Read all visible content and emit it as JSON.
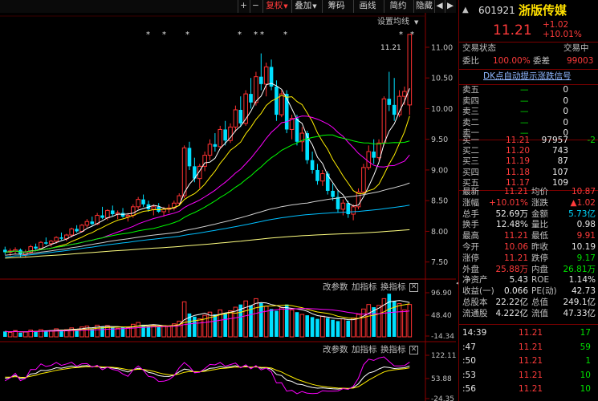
{
  "toolbar": {
    "arrow_left": "<",
    "plus": "+",
    "minus": "−",
    "fuquan": "复权",
    "diejia": "叠加",
    "chouma": "筹码",
    "huaxian": "画线",
    "jianji": "简约",
    "yincang": "隐藏",
    "nav_left": "◀",
    "nav_right": "▶"
  },
  "main_chart": {
    "ma_setting": "设置均线",
    "high_label": "11.21",
    "price_ticks": [
      "11.00",
      "10.50",
      "10.00",
      "9.50",
      "9.00",
      "8.50",
      "8.00",
      "7.50"
    ],
    "star_marks": [
      "*",
      "*",
      "*",
      "*",
      "*",
      "*",
      "*",
      "*",
      "*"
    ]
  },
  "vol_panel": {
    "ctl_change": "改参数",
    "ctl_add": "加指标",
    "ctl_switch": "换指标",
    "ctl_close": "✕",
    "ticks": [
      "96.90",
      "48.40",
      "-14.34"
    ]
  },
  "kdj_panel": {
    "ctl_change": "改参数",
    "ctl_add": "加指标",
    "ctl_switch": "换指标",
    "ctl_close": "✕",
    "ticks": [
      "122.11",
      "53.88",
      "-24.35"
    ]
  },
  "chart_data": {
    "type": "candlestick",
    "ylim": [
      7.3,
      11.3
    ],
    "candles": [
      [
        7.7,
        7.75,
        7.62,
        7.66
      ],
      [
        7.66,
        7.72,
        7.6,
        7.68
      ],
      [
        7.68,
        7.74,
        7.63,
        7.7
      ],
      [
        7.7,
        7.72,
        7.58,
        7.62
      ],
      [
        7.62,
        7.7,
        7.57,
        7.66
      ],
      [
        7.66,
        7.78,
        7.64,
        7.75
      ],
      [
        7.75,
        7.8,
        7.7,
        7.72
      ],
      [
        7.72,
        7.84,
        7.7,
        7.82
      ],
      [
        7.82,
        7.9,
        7.78,
        7.8
      ],
      [
        7.8,
        7.86,
        7.75,
        7.84
      ],
      [
        7.84,
        7.92,
        7.8,
        7.9
      ],
      [
        7.9,
        7.98,
        7.86,
        7.88
      ],
      [
        7.88,
        7.96,
        7.84,
        7.94
      ],
      [
        7.94,
        8.06,
        7.9,
        8.04
      ],
      [
        8.04,
        8.1,
        7.98,
        8.0
      ],
      [
        8.0,
        8.12,
        7.98,
        8.1
      ],
      [
        8.1,
        8.2,
        8.06,
        8.16
      ],
      [
        8.16,
        8.24,
        8.1,
        8.12
      ],
      [
        8.12,
        8.3,
        8.1,
        8.26
      ],
      [
        8.26,
        8.4,
        8.2,
        8.22
      ],
      [
        8.22,
        8.36,
        8.18,
        8.34
      ],
      [
        8.34,
        8.42,
        8.25,
        8.28
      ],
      [
        8.28,
        8.34,
        8.2,
        8.3
      ],
      [
        8.3,
        8.38,
        8.22,
        8.24
      ],
      [
        8.24,
        8.3,
        8.16,
        8.26
      ],
      [
        8.26,
        8.44,
        8.22,
        8.4
      ],
      [
        8.4,
        8.56,
        8.36,
        8.52
      ],
      [
        8.52,
        8.6,
        8.4,
        8.44
      ],
      [
        8.44,
        8.5,
        8.32,
        8.36
      ],
      [
        8.36,
        8.44,
        8.26,
        8.4
      ],
      [
        8.4,
        8.46,
        8.3,
        8.32
      ],
      [
        8.32,
        8.4,
        8.24,
        8.36
      ],
      [
        8.36,
        8.44,
        8.3,
        8.38
      ],
      [
        8.38,
        8.5,
        8.34,
        8.46
      ],
      [
        8.46,
        8.62,
        8.42,
        8.58
      ],
      [
        8.58,
        9.4,
        8.54,
        9.36
      ],
      [
        9.36,
        9.46,
        9.0,
        9.06
      ],
      [
        9.06,
        9.2,
        8.8,
        8.86
      ],
      [
        8.86,
        9.1,
        8.7,
        9.06
      ],
      [
        9.06,
        9.3,
        8.98,
        9.24
      ],
      [
        9.24,
        9.5,
        9.16,
        9.42
      ],
      [
        9.42,
        9.6,
        9.3,
        9.38
      ],
      [
        9.38,
        9.72,
        9.36,
        9.66
      ],
      [
        9.66,
        9.8,
        9.4,
        9.48
      ],
      [
        9.48,
        9.76,
        9.44,
        9.7
      ],
      [
        9.7,
        10.05,
        9.62,
        9.98
      ],
      [
        9.98,
        10.2,
        9.7,
        9.76
      ],
      [
        9.76,
        10.3,
        9.72,
        10.24
      ],
      [
        10.24,
        10.5,
        10.0,
        10.1
      ],
      [
        10.1,
        10.6,
        10.05,
        10.52
      ],
      [
        10.52,
        10.9,
        10.3,
        10.4
      ],
      [
        10.4,
        10.75,
        10.2,
        10.68
      ],
      [
        10.68,
        10.8,
        10.3,
        10.36
      ],
      [
        10.36,
        10.46,
        9.8,
        9.9
      ],
      [
        9.9,
        10.3,
        9.86,
        10.24
      ],
      [
        10.24,
        10.3,
        9.6,
        9.66
      ],
      [
        9.66,
        9.9,
        9.5,
        9.84
      ],
      [
        9.84,
        9.9,
        9.4,
        9.46
      ],
      [
        9.46,
        9.7,
        9.3,
        9.6
      ],
      [
        9.6,
        9.64,
        9.1,
        9.16
      ],
      [
        9.16,
        9.3,
        8.94,
        9.0
      ],
      [
        9.0,
        9.1,
        8.76,
        8.82
      ],
      [
        8.82,
        9.0,
        8.74,
        8.94
      ],
      [
        8.94,
        8.98,
        8.6,
        8.66
      ],
      [
        8.66,
        8.78,
        8.5,
        8.56
      ],
      [
        8.56,
        8.66,
        8.3,
        8.36
      ],
      [
        8.36,
        8.52,
        8.26,
        8.46
      ],
      [
        8.46,
        8.5,
        8.22,
        8.28
      ],
      [
        8.28,
        8.44,
        8.18,
        8.4
      ],
      [
        8.4,
        8.7,
        8.36,
        8.64
      ],
      [
        8.64,
        9.1,
        8.6,
        9.04
      ],
      [
        9.04,
        9.4,
        9.0,
        9.3
      ],
      [
        9.3,
        9.5,
        9.1,
        9.2
      ],
      [
        9.2,
        9.5,
        9.16,
        9.44
      ],
      [
        9.44,
        10.2,
        9.4,
        10.16
      ],
      [
        10.16,
        10.6,
        9.96,
        10.06
      ],
      [
        10.06,
        10.5,
        9.8,
        9.9
      ],
      [
        9.9,
        10.3,
        9.86,
        10.2
      ],
      [
        10.2,
        10.36,
        10.06,
        10.28
      ],
      [
        10.06,
        11.21,
        9.9,
        11.21
      ]
    ],
    "volumes": [
      12,
      10,
      14,
      9,
      11,
      15,
      12,
      16,
      13,
      14,
      18,
      15,
      16,
      20,
      17,
      22,
      24,
      19,
      26,
      23,
      25,
      21,
      19,
      22,
      20,
      28,
      32,
      27,
      24,
      26,
      22,
      25,
      23,
      29,
      35,
      78,
      52,
      45,
      40,
      48,
      55,
      50,
      60,
      52,
      58,
      66,
      72,
      80,
      70,
      85,
      75,
      68,
      62,
      58,
      65,
      72,
      60,
      55,
      50,
      48,
      44,
      40,
      46,
      42,
      38,
      35,
      40,
      36,
      42,
      50,
      62,
      72,
      66,
      70,
      85,
      96,
      80,
      74,
      60,
      72
    ],
    "vol_labels": [
      "96.90",
      "48.40",
      "-14.34"
    ],
    "kdj_labels": [
      "122.11",
      "53.88",
      "-24.35"
    ]
  },
  "quote": {
    "code": "601921",
    "name": "浙版传媒",
    "price": "11.21",
    "change": "+1.02",
    "change_pct": "+10.01%",
    "state_label": "交易状态",
    "state_value": "交易中",
    "weibi_label": "委比",
    "weibi_value": "100.00%",
    "weicha_label": "委差",
    "weicha_value": "99003",
    "signal_text": "DK点自动提示涨跌信号",
    "asks": [
      {
        "label": "卖五",
        "price": "—",
        "vol": "0"
      },
      {
        "label": "卖四",
        "price": "—",
        "vol": "0"
      },
      {
        "label": "卖三",
        "price": "—",
        "vol": "0"
      },
      {
        "label": "卖二",
        "price": "—",
        "vol": "0"
      },
      {
        "label": "卖一",
        "price": "—",
        "vol": "0"
      }
    ],
    "bids": [
      {
        "label": "买一",
        "price": "11.21",
        "vol": "97957",
        "chg": "-2"
      },
      {
        "label": "买二",
        "price": "11.20",
        "vol": "743",
        "chg": ""
      },
      {
        "label": "买三",
        "price": "11.19",
        "vol": "87",
        "chg": ""
      },
      {
        "label": "买四",
        "price": "11.18",
        "vol": "107",
        "chg": ""
      },
      {
        "label": "买五",
        "price": "11.17",
        "vol": "109",
        "chg": ""
      }
    ],
    "stats": [
      {
        "l1": "最新",
        "v1": "11.21",
        "c1": "red",
        "l2": "均价",
        "v2": "10.87",
        "c2": "red"
      },
      {
        "l1": "涨幅",
        "v1": "+10.01%",
        "c1": "red",
        "l2": "涨跌",
        "v2": "▲1.02",
        "c2": "red"
      },
      {
        "l1": "总手",
        "v1": "52.69万",
        "c1": "white",
        "l2": "金额",
        "v2": "5.73亿",
        "c2": "cyan"
      },
      {
        "l1": "换手",
        "v1": "12.48%",
        "c1": "white",
        "l2": "量比",
        "v2": "0.98",
        "c2": "white"
      },
      {
        "l1": "最高",
        "v1": "11.21",
        "c1": "red",
        "l2": "最低",
        "v2": "9.91",
        "c2": "red"
      },
      {
        "l1": "今开",
        "v1": "10.06",
        "c1": "red",
        "l2": "昨收",
        "v2": "10.19",
        "c2": "white"
      },
      {
        "l1": "涨停",
        "v1": "11.21",
        "c1": "red",
        "l2": "跌停",
        "v2": "9.17",
        "c2": "green"
      },
      {
        "l1": "外盘",
        "v1": "25.88万",
        "c1": "red",
        "l2": "内盘",
        "v2": "26.81万",
        "c2": "green"
      },
      {
        "l1": "净资产",
        "v1": "5.43",
        "c1": "white",
        "l2": "ROE",
        "v2": "1.14%",
        "c2": "white"
      },
      {
        "l1": "收益(一)",
        "v1": "0.066",
        "c1": "white",
        "l2": "PE(动)",
        "v2": "42.73",
        "c2": "white"
      },
      {
        "l1": "总股本",
        "v1": "22.22亿",
        "c1": "white",
        "l2": "总值",
        "v2": "249.1亿",
        "c2": "white"
      },
      {
        "l1": "流通股",
        "v1": "4.222亿",
        "c1": "white",
        "l2": "流值",
        "v2": "47.33亿",
        "c2": "white"
      }
    ],
    "ticks": [
      {
        "time": "14:39",
        "price": "11.21",
        "vol": "17"
      },
      {
        "time": ":47",
        "price": "11.21",
        "vol": "59"
      },
      {
        "time": ":50",
        "price": "11.21",
        "vol": "1"
      },
      {
        "time": ":53",
        "price": "11.21",
        "vol": "10"
      },
      {
        "time": ":56",
        "price": "11.21",
        "vol": "10"
      }
    ]
  }
}
